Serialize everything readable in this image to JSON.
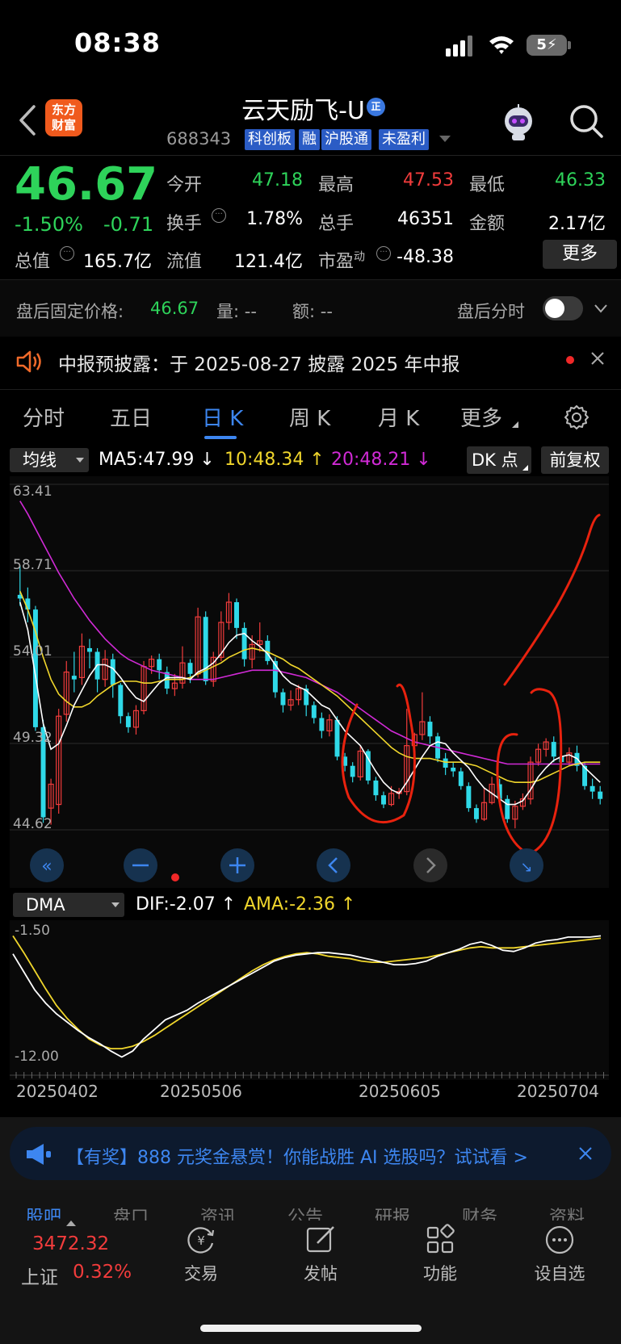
{
  "status_bar": {
    "time": "08:38",
    "battery": "5"
  },
  "header": {
    "logo_text": "东方财富",
    "stock_name": "云天励飞-U",
    "name_badge": "正",
    "stock_code": "688343",
    "tags": [
      "科创板",
      "融",
      "沪股通",
      "未盈利"
    ]
  },
  "quote": {
    "price": "46.67",
    "pct_change": "-1.50%",
    "abs_change": "-0.71",
    "fields": [
      {
        "label": "今开",
        "value": "47.18",
        "color": "green"
      },
      {
        "label": "最高",
        "value": "47.53",
        "color": "red"
      },
      {
        "label": "最低",
        "value": "46.33",
        "color": "green"
      },
      {
        "label": "换手",
        "value": "1.78%",
        "color": "white"
      },
      {
        "label": "总手",
        "value": "46351",
        "color": "white"
      },
      {
        "label": "金额",
        "value": "2.17亿",
        "color": "white"
      },
      {
        "label": "总值",
        "value": "165.7亿",
        "color": "white"
      },
      {
        "label": "流值",
        "value": "121.4亿",
        "color": "white"
      },
      {
        "label": "市盈",
        "label_sup": "动",
        "value": "-48.38",
        "color": "white"
      }
    ],
    "more_label": "更多"
  },
  "after_hours": {
    "label": "盘后固定价格:",
    "price": "46.67",
    "volume": "量:  --",
    "amount": "额:  --",
    "tick_label": "盘后分时"
  },
  "notice": {
    "text": "中报预披露：于 2025-08-27 披露 2025 年中报"
  },
  "tabs": [
    "分时",
    "五日",
    "日 K",
    "周 K",
    "月 K",
    "更多"
  ],
  "active_tab": "日 K",
  "chart_header": {
    "ma_select": "均线",
    "ma5": "MA5:47.99 ↓",
    "ma10": "10:48.34 ↑",
    "ma20": "20:48.21 ↓",
    "dk_button": "DK 点",
    "adjust_button": "前复权"
  },
  "colors": {
    "up": "#f23c3c",
    "down": "#2ed35a",
    "candle_down": "#2fd9e8",
    "ma5": "#ffffff",
    "ma10": "#f0d62c",
    "ma20": "#d12ad6",
    "accent": "#3d86f0",
    "annotation": "#e8220e"
  },
  "chart_data": {
    "type": "candlestick",
    "y_ticks": [
      "63.41",
      "58.71",
      "54.01",
      "49.32",
      "44.62"
    ],
    "ylim": [
      44.62,
      63.41
    ],
    "x_labels": [
      "20250402",
      "20250506",
      "20250605",
      "20250704"
    ],
    "candles": [
      [
        57.4,
        57.2,
        59.0,
        56.8
      ],
      [
        57.2,
        56.6,
        57.8,
        55.9
      ],
      [
        56.6,
        50.2,
        56.8,
        50.0
      ],
      [
        50.2,
        45.3,
        50.6,
        45.0
      ],
      [
        45.8,
        47.1,
        47.4,
        44.9
      ],
      [
        46.0,
        50.8,
        51.2,
        45.5
      ],
      [
        50.9,
        53.2,
        53.8,
        50.5
      ],
      [
        53.0,
        52.8,
        54.3,
        52.1
      ],
      [
        52.9,
        54.6,
        55.3,
        52.5
      ],
      [
        54.5,
        54.3,
        55.0,
        53.4
      ],
      [
        54.3,
        52.8,
        54.5,
        52.1
      ],
      [
        52.8,
        53.9,
        54.4,
        52.4
      ],
      [
        53.9,
        52.5,
        54.2,
        51.8
      ],
      [
        52.5,
        50.8,
        52.6,
        50.4
      ],
      [
        50.8,
        50.2,
        51.0,
        49.9
      ],
      [
        50.2,
        51.1,
        51.4,
        49.8
      ],
      [
        51.1,
        53.5,
        53.8,
        50.9
      ],
      [
        53.5,
        53.9,
        54.1,
        53.1
      ],
      [
        53.9,
        53.3,
        54.2,
        52.8
      ],
      [
        53.2,
        52.3,
        53.5,
        52.0
      ],
      [
        52.3,
        52.6,
        53.1,
        51.9
      ],
      [
        52.6,
        53.7,
        54.6,
        52.3
      ],
      [
        53.7,
        53.1,
        53.9,
        52.6
      ],
      [
        53.1,
        56.2,
        56.7,
        52.9
      ],
      [
        56.2,
        52.7,
        56.5,
        52.5
      ],
      [
        52.7,
        54.0,
        54.3,
        52.4
      ],
      [
        54.0,
        55.9,
        56.5,
        53.8
      ],
      [
        55.9,
        57.0,
        57.5,
        55.5
      ],
      [
        57.0,
        55.6,
        57.2,
        55.0
      ],
      [
        55.6,
        53.9,
        55.9,
        53.5
      ],
      [
        53.9,
        54.7,
        55.2,
        53.4
      ],
      [
        54.7,
        54.9,
        55.9,
        54.3
      ],
      [
        54.9,
        53.8,
        55.2,
        53.6
      ],
      [
        53.8,
        52.1,
        54.0,
        51.8
      ],
      [
        52.1,
        51.4,
        52.3,
        51.0
      ],
      [
        51.4,
        51.7,
        52.2,
        51.1
      ],
      [
        51.7,
        52.3,
        52.5,
        51.4
      ],
      [
        52.3,
        51.4,
        52.5,
        50.8
      ],
      [
        51.4,
        50.7,
        51.6,
        50.4
      ],
      [
        50.7,
        50.0,
        51.0,
        49.6
      ],
      [
        50.0,
        50.6,
        50.9,
        49.7
      ],
      [
        50.6,
        48.6,
        50.8,
        48.4
      ],
      [
        48.6,
        48.1,
        48.8,
        47.8
      ],
      [
        48.1,
        47.5,
        48.3,
        47.2
      ],
      [
        47.5,
        48.9,
        49.2,
        47.3
      ],
      [
        48.9,
        47.3,
        49.0,
        47.1
      ],
      [
        47.3,
        46.5,
        47.5,
        46.2
      ],
      [
        46.5,
        46.0,
        46.7,
        45.8
      ],
      [
        46.0,
        46.6,
        47.0,
        45.9
      ],
      [
        46.6,
        46.7,
        46.9,
        46.3
      ],
      [
        46.7,
        49.2,
        51.2,
        46.5
      ],
      [
        49.2,
        49.8,
        49.9,
        49.1
      ],
      [
        49.8,
        50.5,
        52.1,
        49.5
      ],
      [
        50.5,
        49.7,
        50.8,
        49.3
      ],
      [
        49.7,
        48.5,
        49.9,
        48.3
      ],
      [
        48.5,
        48.0,
        48.8,
        47.6
      ],
      [
        48.0,
        47.8,
        48.3,
        47.5
      ],
      [
        47.8,
        47.0,
        48.0,
        46.8
      ],
      [
        47.0,
        45.8,
        47.2,
        45.6
      ],
      [
        45.8,
        45.2,
        46.0,
        45.0
      ],
      [
        45.2,
        46.1,
        46.9,
        45.1
      ],
      [
        46.1,
        47.1,
        47.5,
        46.0
      ],
      [
        47.1,
        46.3,
        47.4,
        46.0
      ],
      [
        46.3,
        45.2,
        46.5,
        45.0
      ],
      [
        45.2,
        45.9,
        46.2,
        44.7
      ],
      [
        45.9,
        46.3,
        46.6,
        45.7
      ],
      [
        46.3,
        48.3,
        48.6,
        46.0
      ],
      [
        48.3,
        49.0,
        49.3,
        48.1
      ],
      [
        49.0,
        49.4,
        49.6,
        48.6
      ],
      [
        49.4,
        48.6,
        49.7,
        48.3
      ],
      [
        48.6,
        48.3,
        48.8,
        47.9
      ],
      [
        48.3,
        48.8,
        49.1,
        48.1
      ],
      [
        48.8,
        48.1,
        49.2,
        47.8
      ],
      [
        48.1,
        47.0,
        48.3,
        46.8
      ],
      [
        47.0,
        46.7,
        47.4,
        46.3
      ],
      [
        46.7,
        46.3,
        47.0,
        46.0
      ]
    ],
    "ma5": [
      57.0,
      55.5,
      53.0,
      50.4,
      49.0,
      49.3,
      50.3,
      51.4,
      52.2,
      53.0,
      53.6,
      53.6,
      53.4,
      52.9,
      52.3,
      51.8,
      51.6,
      52.1,
      52.6,
      52.9,
      52.9,
      52.9,
      52.8,
      53.2,
      53.4,
      53.7,
      54.2,
      54.8,
      55.2,
      55.3,
      54.9,
      54.6,
      54.2,
      53.6,
      53.0,
      52.6,
      52.4,
      52.2,
      51.8,
      51.4,
      51.2,
      50.6,
      50.0,
      49.6,
      49.2,
      48.5,
      47.8,
      47.2,
      46.8,
      46.6,
      47.2,
      47.9,
      48.6,
      49.2,
      49.4,
      49.3,
      48.8,
      48.4,
      48.0,
      47.4,
      46.9,
      46.6,
      46.3,
      46.0,
      46.0,
      46.2,
      46.8,
      47.5,
      48.0,
      48.4,
      48.6,
      48.7,
      48.5,
      48.0,
      47.6,
      47.2
    ],
    "ma10": [
      57.6,
      56.6,
      55.4,
      54.0,
      52.8,
      52.0,
      51.6,
      51.3,
      51.3,
      51.5,
      51.9,
      52.2,
      52.5,
      52.7,
      52.7,
      52.7,
      52.6,
      52.6,
      52.7,
      52.8,
      52.8,
      52.8,
      52.9,
      53.1,
      53.3,
      53.5,
      53.7,
      54.0,
      54.2,
      54.4,
      54.5,
      54.4,
      54.3,
      54.1,
      53.9,
      53.6,
      53.4,
      53.1,
      52.8,
      52.5,
      52.2,
      51.9,
      51.5,
      51.1,
      50.7,
      50.3,
      49.9,
      49.5,
      49.1,
      48.8,
      48.6,
      48.5,
      48.5,
      48.5,
      48.4,
      48.3,
      48.3,
      48.3,
      48.2,
      48.1,
      47.9,
      47.7,
      47.5,
      47.3,
      47.2,
      47.2,
      47.2,
      47.3,
      47.5,
      47.7,
      47.9,
      48.1,
      48.2,
      48.3,
      48.3,
      48.3
    ],
    "ma20": [
      62.5,
      61.8,
      61.0,
      60.2,
      59.4,
      58.6,
      57.9,
      57.2,
      56.6,
      56.0,
      55.5,
      55.0,
      54.6,
      54.2,
      53.9,
      53.7,
      53.5,
      53.3,
      53.2,
      53.1,
      53.0,
      52.9,
      52.8,
      52.8,
      52.8,
      52.8,
      52.9,
      53.0,
      53.1,
      53.2,
      53.3,
      53.3,
      53.3,
      53.3,
      53.2,
      53.1,
      53.0,
      52.9,
      52.7,
      52.5,
      52.3,
      52.1,
      51.8,
      51.5,
      51.2,
      50.9,
      50.6,
      50.3,
      50.0,
      49.8,
      49.6,
      49.4,
      49.3,
      49.2,
      49.1,
      49.0,
      48.9,
      48.8,
      48.7,
      48.6,
      48.5,
      48.4,
      48.3,
      48.2,
      48.2,
      48.2,
      48.2,
      48.2,
      48.2,
      48.2,
      48.2,
      48.2,
      48.2,
      48.2,
      48.2,
      48.2
    ]
  },
  "macd": {
    "select": "DMA",
    "dif_text": "DIF:-2.07 ↑",
    "ama_text": "AMA:-2.36 ↑",
    "y_ticks": [
      "-1.50",
      "-12.00"
    ],
    "ylim": [
      -12.0,
      -1.5
    ],
    "dif": [
      -3.5,
      -5.0,
      -6.5,
      -7.6,
      -8.5,
      -9.2,
      -9.9,
      -10.5,
      -11.0,
      -11.6,
      -12.1,
      -11.6,
      -10.6,
      -9.8,
      -9.0,
      -8.6,
      -8.2,
      -7.6,
      -7.1,
      -6.6,
      -6.1,
      -5.6,
      -5.1,
      -4.6,
      -4.1,
      -3.8,
      -3.6,
      -3.5,
      -3.4,
      -3.4,
      -3.5,
      -3.6,
      -3.8,
      -4.0,
      -4.2,
      -4.4,
      -4.4,
      -4.3,
      -4.1,
      -3.7,
      -3.4,
      -3.1,
      -2.7,
      -2.5,
      -2.8,
      -3.2,
      -3.3,
      -3.0,
      -2.6,
      -2.4,
      -2.3,
      -2.1,
      -2.1,
      -2.1,
      -2.0
    ],
    "ama": [
      -2.0,
      -3.4,
      -4.9,
      -6.4,
      -7.8,
      -8.9,
      -9.8,
      -10.6,
      -11.1,
      -11.4,
      -11.4,
      -11.2,
      -10.8,
      -10.3,
      -9.7,
      -9.1,
      -8.5,
      -7.9,
      -7.3,
      -6.7,
      -6.1,
      -5.5,
      -4.9,
      -4.4,
      -4.0,
      -3.7,
      -3.5,
      -3.4,
      -3.5,
      -3.7,
      -3.8,
      -3.9,
      -4.1,
      -4.2,
      -4.2,
      -4.1,
      -4.0,
      -3.9,
      -3.8,
      -3.6,
      -3.4,
      -3.2,
      -3.0,
      -2.9,
      -3.0,
      -3.0,
      -3.0,
      -2.9,
      -2.8,
      -2.7,
      -2.6,
      -2.5,
      -2.4,
      -2.3,
      -2.2
    ]
  },
  "ad": {
    "text": "【有奖】888 元奖金悬赏！你能战胜 AI 选股吗？试试看 >"
  },
  "bottom_tabs": [
    "股吧",
    "盘口",
    "资讯",
    "公告",
    "研报",
    "财务",
    "资料"
  ],
  "index": {
    "value": "3472.32",
    "name": "上证",
    "pct": "0.32%"
  },
  "nav": [
    {
      "label": "交易",
      "icon": "yuan-cycle-icon"
    },
    {
      "label": "发帖",
      "icon": "edit-icon"
    },
    {
      "label": "功能",
      "icon": "grid-icon"
    },
    {
      "label": "设自选",
      "icon": "more-circle-icon"
    }
  ]
}
